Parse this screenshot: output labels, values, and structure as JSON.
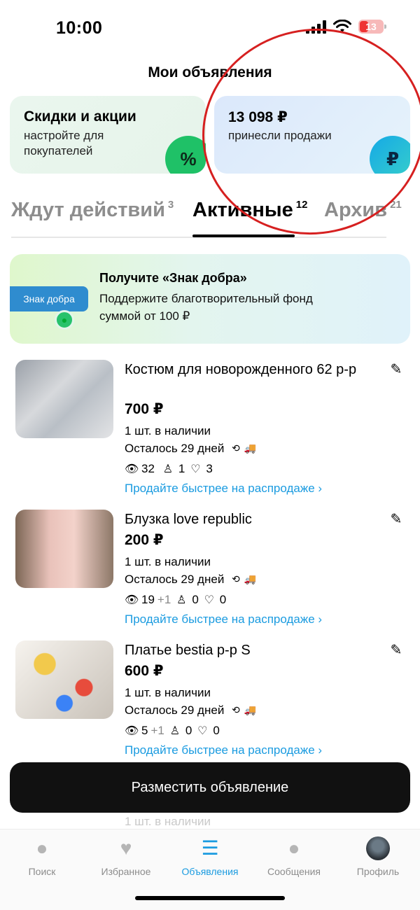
{
  "status": {
    "time": "10:00",
    "battery": "13"
  },
  "header": {
    "title": "Мои объявления"
  },
  "cards": {
    "discount": {
      "title": "Скидки и акции",
      "subtitle": "настройте для покупателей",
      "icon": "percent-icon"
    },
    "sales": {
      "title": "13 098 ₽",
      "subtitle": "принесли продажи",
      "icon": "ruble-icon"
    }
  },
  "tabs": [
    {
      "label": "Ждут действий",
      "count": "3"
    },
    {
      "label": "Активные",
      "count": "12"
    },
    {
      "label": "Архив",
      "count": "21"
    }
  ],
  "charity": {
    "tag": "Знак добра",
    "title": "Получите «Знак добра»",
    "text": "Поддержите благотворительный фонд суммой от 100 ₽"
  },
  "listings": [
    {
      "title": "Костюм для новорожденного 62 р-р",
      "price": "700 ₽",
      "qty": "1 шт. в наличии",
      "left": "Осталось 29 дней",
      "views": "32",
      "views_plus": "",
      "contacts": "1",
      "favorites": "3",
      "promo": "Продайте быстрее на распродаже ›"
    },
    {
      "title": "Блузка love republic",
      "price": "200 ₽",
      "qty": "1 шт. в наличии",
      "left": "Осталось 29 дней",
      "views": "19",
      "views_plus": "+1",
      "contacts": "0",
      "favorites": "0",
      "promo": "Продайте быстрее на распродаже ›"
    },
    {
      "title": "Платье bestia р-р S",
      "price": "600 ₽",
      "qty": "1 шт. в наличии",
      "left": "Осталось 29 дней",
      "views": "5",
      "views_plus": "+1",
      "contacts": "0",
      "favorites": "0",
      "promo": "Продайте быстрее на распродаже ›"
    }
  ],
  "partial_listing": {
    "qty": "1 шт. в наличии"
  },
  "place_button": {
    "label": "Разместить объявление"
  },
  "nav": [
    {
      "label": "Поиск",
      "icon": "search-icon"
    },
    {
      "label": "Избранное",
      "icon": "heart-icon"
    },
    {
      "label": "Объявления",
      "icon": "listings-icon"
    },
    {
      "label": "Сообщения",
      "icon": "chat-icon"
    },
    {
      "label": "Профиль",
      "icon": "avatar"
    }
  ],
  "colors": {
    "accent": "#1a9be0",
    "green": "#1fc167",
    "annotation": "#d62020"
  }
}
